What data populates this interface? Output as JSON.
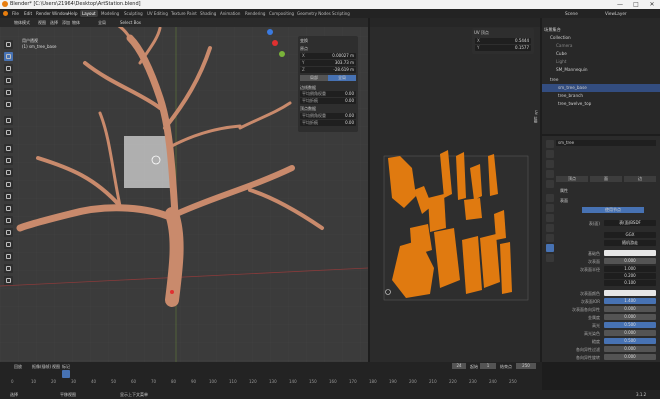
{
  "titlebar": {
    "title": "Blender* [C:\\Users\\21964\\Desktop\\ArtStation.blend]",
    "min": "—",
    "max": "□",
    "close": "✕"
  },
  "menubar": {
    "menus": [
      "File",
      "Edit",
      "Render",
      "Window",
      "Help"
    ],
    "workspaces": [
      "Layout",
      "Modeling",
      "Sculpting",
      "UV Editing",
      "Texture Paint",
      "Shading",
      "Animation",
      "Rendering",
      "Compositing",
      "Geometry Nodes",
      "Scripting"
    ],
    "scene": "Scene",
    "view_layer": "ViewLayer"
  },
  "viewport": {
    "mode": "物体模式",
    "view": "视图",
    "select": "选择",
    "add": "添加",
    "object": "物体",
    "global": "全局",
    "select_box": "Select Box",
    "info_line1": "用户透视",
    "info_line2": "(1) sm_tree_base"
  },
  "npanel": {
    "title": "变换",
    "section_pos": "原点",
    "x": "0.00027 m",
    "y": "303.73 m",
    "z": "-28.619 m",
    "local": "局部",
    "global": "全局",
    "section2": "边线数据",
    "bevel": "平均倒角权重",
    "bevel_val": "0.00",
    "crease": "平均折痕",
    "crease_val": "0.00",
    "section3": "顶点数据",
    "vbevel": "平均倒角权重",
    "vbevel_val": "0.00",
    "vcrease": "平均折痕",
    "vcrease_val": "0.00"
  },
  "uv": {
    "title": "UV 顶点",
    "x": "0.5444",
    "y": "0.1577",
    "side_tab": "UV 拉伸"
  },
  "outliner": {
    "title": "场景集合",
    "items": [
      "Collection",
      "Camera",
      "Cube",
      "Light",
      "SM_Mannequin",
      "tree",
      "sm_tree_base",
      "tree_branch",
      "tree_twelve_top"
    ]
  },
  "props": {
    "object_name": "sm_tree",
    "tabs": [
      "顶点",
      "面",
      "边"
    ],
    "section_a": "属性",
    "section_b": "表面",
    "use_nodes_btn": "使用节点",
    "surface": "表(面)BSDF",
    "distribution": "GGX",
    "sss_method": "随机游走",
    "rows": [
      {
        "k": "基础色",
        "v": ""
      },
      {
        "k": "次表面",
        "v": "0.000"
      },
      {
        "k": "次表面半径",
        "v": "1.000"
      },
      {
        "k": "",
        "v": "0.200"
      },
      {
        "k": "",
        "v": "0.100"
      },
      {
        "k": "次表面颜色",
        "v": ""
      },
      {
        "k": "次表面IOR",
        "v": "1.400"
      },
      {
        "k": "次表面各向异性",
        "v": "0.000"
      },
      {
        "k": "金属度",
        "v": "0.000"
      },
      {
        "k": "高光",
        "v": "0.500"
      },
      {
        "k": "高光染色",
        "v": "0.000"
      },
      {
        "k": "糙度",
        "v": "0.500"
      },
      {
        "k": "各向异性过滤",
        "v": "0.000"
      },
      {
        "k": "各向异性旋转",
        "v": "0.000"
      },
      {
        "k": "光泽",
        "v": "0.000"
      },
      {
        "k": "光泽染色",
        "v": "0.500"
      },
      {
        "k": "清漆",
        "v": "0.000"
      }
    ]
  },
  "timeline": {
    "playback": "回放",
    "keying": "抠像(插帧)",
    "view": "视图",
    "marker": "标记",
    "current_frame": "24",
    "start_label": "起始",
    "start": "1",
    "end_label": "结束点",
    "end": "250",
    "ticks": [
      "0",
      "10",
      "20",
      "30",
      "40",
      "50",
      "60",
      "70",
      "80",
      "90",
      "100",
      "110",
      "120",
      "130",
      "140",
      "150",
      "160",
      "170",
      "180",
      "190",
      "200",
      "210",
      "220",
      "230",
      "240",
      "250"
    ]
  },
  "statusbar": {
    "left": "选择",
    "mid": "平移视图",
    "right": "显示上下文菜单",
    "version": "3.1.2"
  },
  "colors": {
    "accent": "#4772b3",
    "orange": "#e07a10",
    "tree": "#c98a6c"
  }
}
